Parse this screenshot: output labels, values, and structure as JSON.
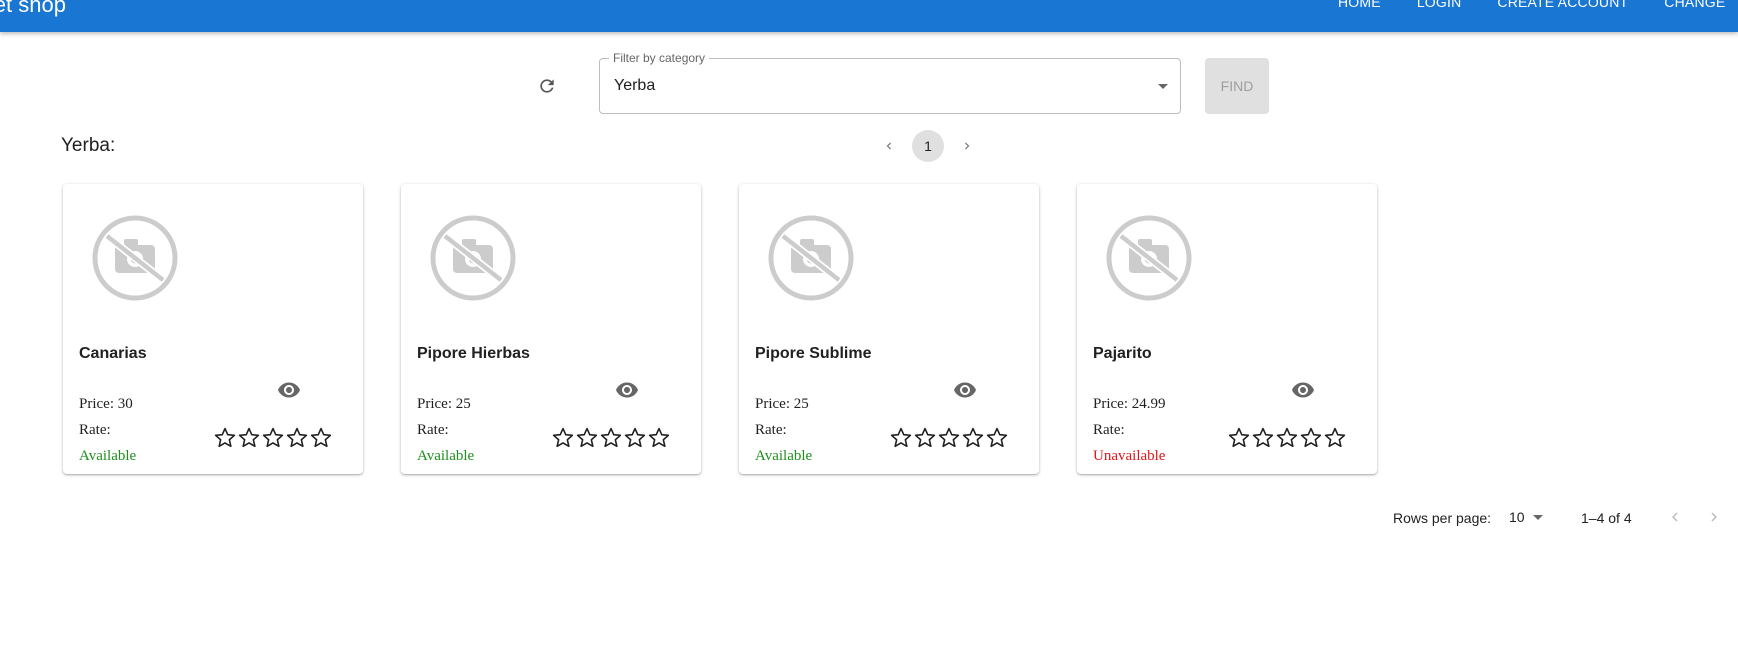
{
  "appbar": {
    "brand": "ernet shop",
    "nav": [
      {
        "label": "HOME"
      },
      {
        "label": "LOGIN"
      },
      {
        "label": "CREATE ACCOUNT"
      },
      {
        "label": "CHANGE"
      }
    ],
    "color": "#1976d2"
  },
  "filter": {
    "legend": "Filter by category",
    "selected": "Yerba",
    "find_label": "FIND",
    "refresh_icon": "refresh-icon"
  },
  "section": {
    "title": "Yerba:"
  },
  "pager": {
    "current_page": "1"
  },
  "labels": {
    "rate": "Rate:"
  },
  "products": [
    {
      "name": "Canarias",
      "price": "Price: 30",
      "status": "Available",
      "status_color": "#1e8e1e",
      "rating": 0
    },
    {
      "name": "Pipore Hierbas",
      "price": "Price: 25",
      "status": "Available",
      "status_color": "#1e8e1e",
      "rating": 0
    },
    {
      "name": "Pipore Sublime",
      "price": "Price: 25",
      "status": "Available",
      "status_color": "#1e8e1e",
      "rating": 0
    },
    {
      "name": "Pajarito",
      "price": "Price: 24.99",
      "status": "Unavailable",
      "status_color": "#e0151b",
      "rating": 0
    }
  ],
  "table_pagination": {
    "rows_label": "Rows per page:",
    "rows_value": "10",
    "range": "1–4 of 4"
  }
}
